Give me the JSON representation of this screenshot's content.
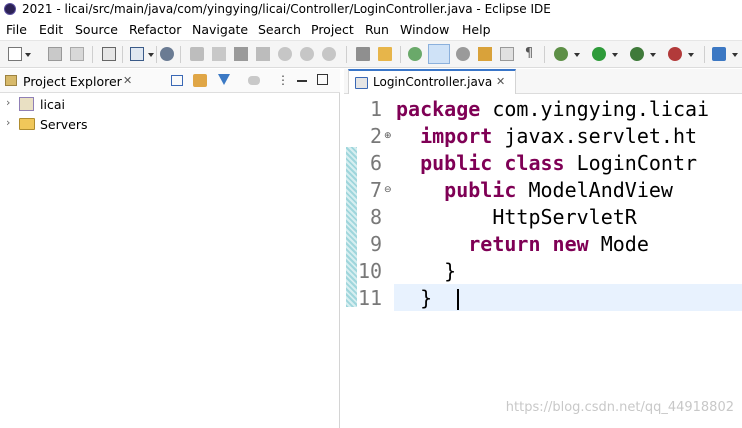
{
  "window": {
    "title": "2021 - licai/src/main/java/com/yingying/licai/Controller/LoginController.java - Eclipse IDE"
  },
  "menu": [
    "File",
    "Edit",
    "Source",
    "Refactor",
    "Navigate",
    "Search",
    "Project",
    "Run",
    "Window",
    "Help"
  ],
  "explorer": {
    "tab_label": "Project Explorer",
    "close_glyph": "✕",
    "items": [
      {
        "label": "licai",
        "icon": "maven-project-icon"
      },
      {
        "label": "Servers",
        "icon": "folder-icon"
      }
    ]
  },
  "editor": {
    "tab_label": "LoginController.java",
    "close_glyph": "✕",
    "lines": [
      {
        "num": "1",
        "fold": "",
        "parts": [
          {
            "t": "package",
            "kw": true
          },
          {
            "t": " com.yingying.licai",
            "kw": false
          }
        ]
      },
      {
        "num": "2",
        "fold": "⊕",
        "parts": [
          {
            "t": "  ",
            "kw": false
          },
          {
            "t": "import",
            "kw": true
          },
          {
            "t": " javax.servlet.ht",
            "kw": false
          }
        ]
      },
      {
        "num": "6",
        "fold": "",
        "parts": [
          {
            "t": "  ",
            "kw": false
          },
          {
            "t": "public class",
            "kw": true
          },
          {
            "t": " LoginContr",
            "kw": false
          }
        ]
      },
      {
        "num": "7",
        "fold": "⊖",
        "parts": [
          {
            "t": "    ",
            "kw": false
          },
          {
            "t": "public",
            "kw": true
          },
          {
            "t": " ModelAndView",
            "kw": false
          }
        ]
      },
      {
        "num": "8",
        "fold": "",
        "parts": [
          {
            "t": "        HttpServletR",
            "kw": false
          }
        ]
      },
      {
        "num": "9",
        "fold": "",
        "parts": [
          {
            "t": "      ",
            "kw": false
          },
          {
            "t": "return new",
            "kw": true
          },
          {
            "t": " Mode",
            "kw": false
          }
        ]
      },
      {
        "num": "10",
        "fold": "",
        "parts": [
          {
            "t": "    }",
            "kw": false
          }
        ]
      },
      {
        "num": "11",
        "fold": "",
        "parts": [
          {
            "t": "  }",
            "kw": false
          }
        ]
      }
    ]
  },
  "watermark": "https://blog.csdn.net/qq_44918802",
  "colors": {
    "keyword": "#7f0055",
    "current_line": "#e8f2fe",
    "active_tab": "#3a76c8"
  }
}
